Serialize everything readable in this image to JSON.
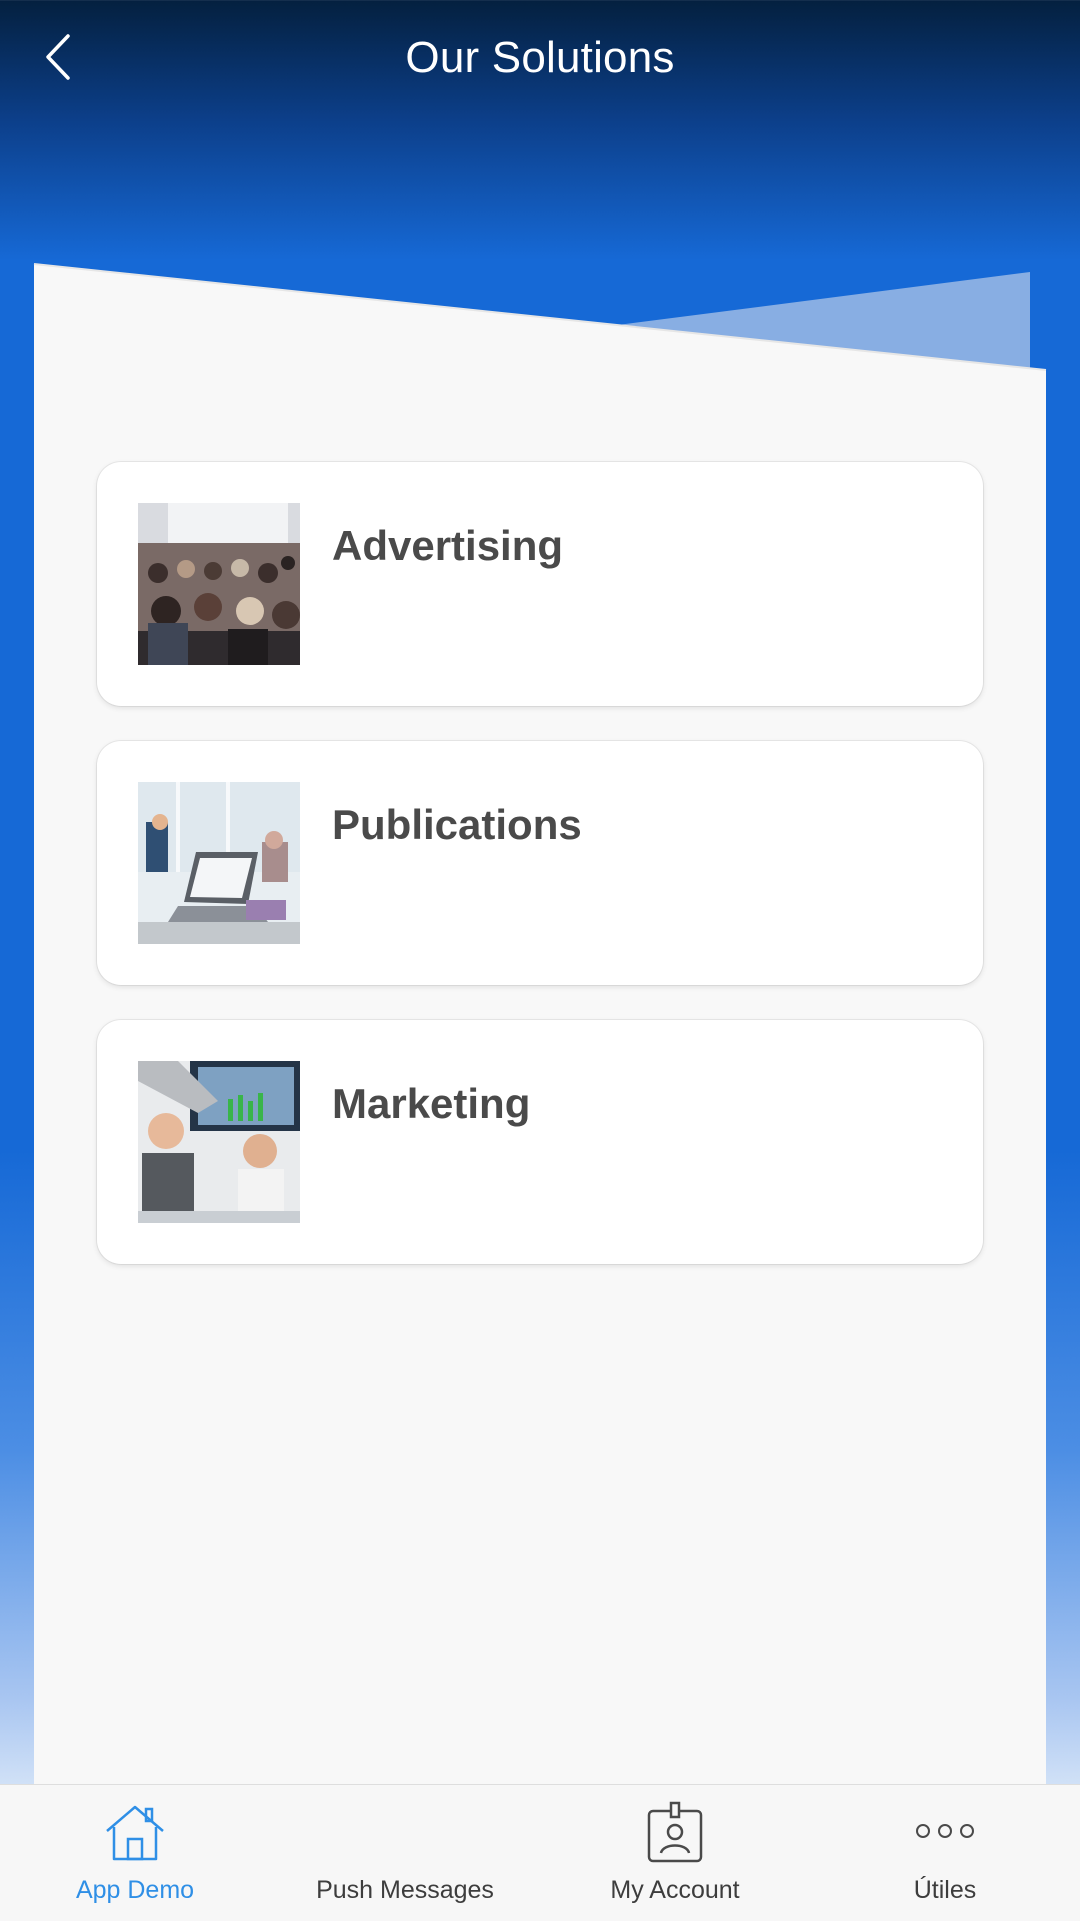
{
  "header": {
    "title": "Our Solutions"
  },
  "solutions": [
    {
      "title": "Advertising"
    },
    {
      "title": "Publications"
    },
    {
      "title": "Marketing"
    }
  ],
  "tabbar": {
    "items": [
      {
        "label": "App Demo",
        "icon": "home-icon",
        "active": true
      },
      {
        "label": "Push Messages",
        "icon": "",
        "active": false
      },
      {
        "label": "My Account",
        "icon": "id-badge-icon",
        "active": false
      },
      {
        "label": "Útiles",
        "icon": "more-dots-icon",
        "active": false
      }
    ]
  },
  "colors": {
    "header_dark": "#04203f",
    "primary_blue": "#1669d6",
    "active_tab": "#2f8fe6",
    "card_text": "#4a4a4a",
    "panel_bg": "#f8f8f8"
  }
}
